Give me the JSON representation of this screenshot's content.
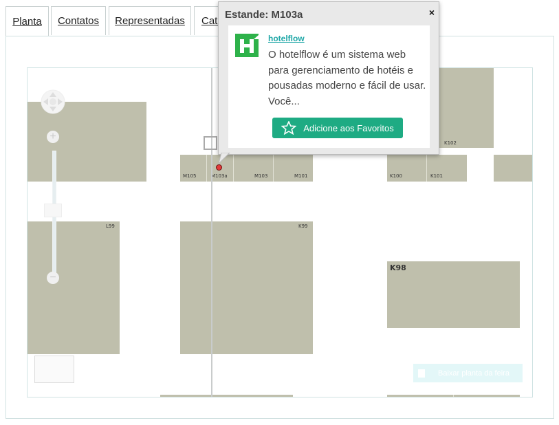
{
  "tabs": [
    {
      "label": "Planta",
      "active": true
    },
    {
      "label": "Contatos"
    },
    {
      "label": "Representadas"
    },
    {
      "label": "Cate"
    }
  ],
  "map": {
    "booths": {
      "m105": "M105",
      "m103a": "M103a",
      "m103": "M103",
      "m101": "M101",
      "k100": "K100",
      "k101": "K101",
      "k102": "K102",
      "l99": "L99",
      "k99": "K99",
      "k98": "K98"
    },
    "download_label": "Baixar planta da feira",
    "booth_color": "#bfbfac"
  },
  "popup": {
    "title": "Estande: M103a",
    "close_label": "×",
    "company": "hotelflow",
    "description": "O hotelflow é um sistema web para gerenciamento de hotéis e pousadas moderno e fácil de usar. Você...",
    "favorite_label": "Adicione aos Favoritos",
    "accent": "#1eab83"
  }
}
